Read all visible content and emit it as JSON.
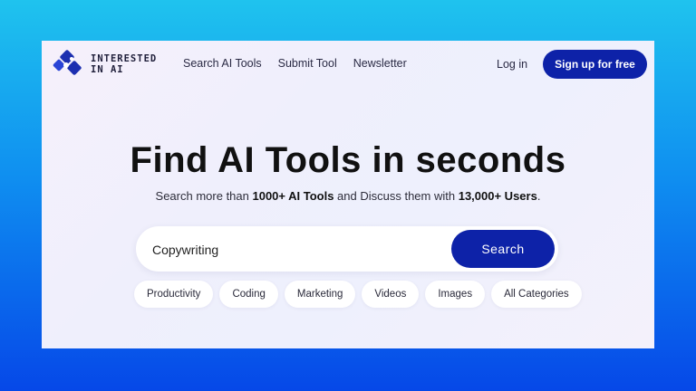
{
  "brand": {
    "line1": "INTERESTED",
    "line2": "IN AI"
  },
  "nav": {
    "links": [
      "Search AI Tools",
      "Submit Tool",
      "Newsletter"
    ],
    "login": "Log in",
    "signup": "Sign up for free"
  },
  "hero": {
    "title": "Find AI Tools in seconds",
    "sub_pre": "Search more than ",
    "sub_tools": "1000+ AI Tools",
    "sub_mid": " and Discuss them with ",
    "sub_users": "13,000+ Users",
    "sub_end": "."
  },
  "search": {
    "value": "Copywriting",
    "button": "Search"
  },
  "categories": [
    "Productivity",
    "Coding",
    "Marketing",
    "Videos",
    "Images",
    "All Categories"
  ],
  "colors": {
    "primary": "#0d22a8",
    "outer_top": "#1fc3ee",
    "outer_bottom": "#0648e8"
  }
}
